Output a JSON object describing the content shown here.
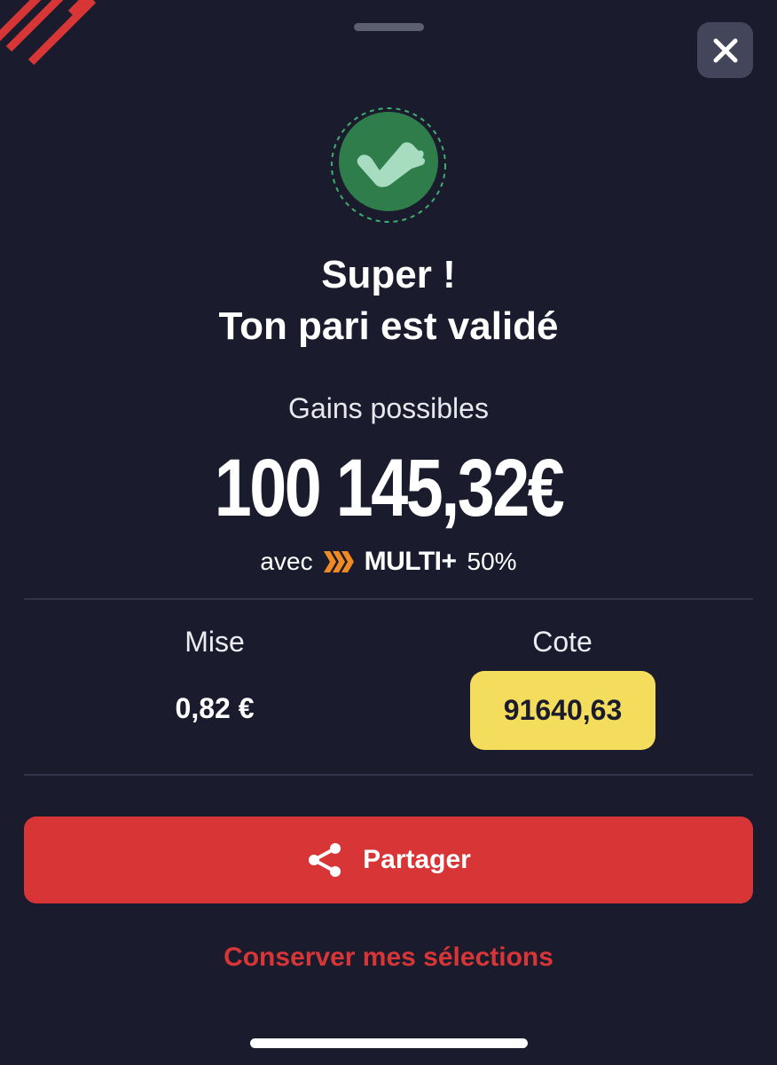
{
  "header": {
    "close_icon": "close-icon"
  },
  "confirmation": {
    "icon": "check-shaka-icon",
    "title_line1": "Super !",
    "title_line2": "Ton pari est validé"
  },
  "gains": {
    "label": "Gains possibles",
    "amount": "100 145,32€",
    "boost_prefix": "avec",
    "boost_icon": "chevrons-icon",
    "boost_brand": "MULTI+",
    "boost_percent": "50%"
  },
  "bet": {
    "stake_label": "Mise",
    "stake_value": "0,82 €",
    "odds_label": "Cote",
    "odds_value": "91640,63"
  },
  "actions": {
    "share_label": "Partager",
    "share_icon": "share-icon",
    "keep_label": "Conserver mes sélections"
  },
  "colors": {
    "background": "#1a1c2e",
    "accent_red": "#d83636",
    "odds_yellow": "#f4dc5c",
    "success_green": "#2e7d4a",
    "boost_orange": "#f08a24"
  }
}
